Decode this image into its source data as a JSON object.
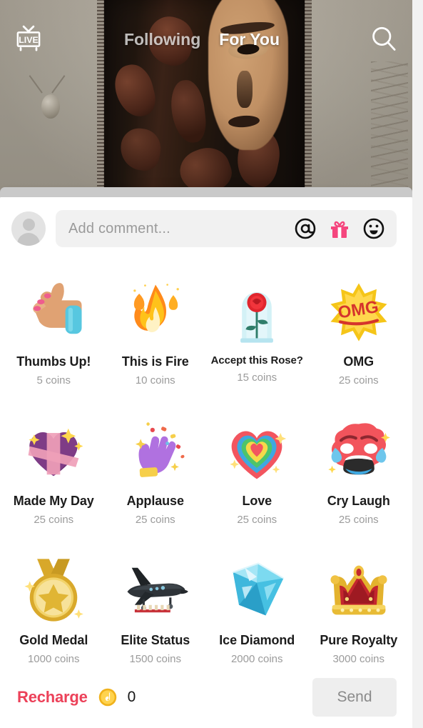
{
  "topnav": {
    "live_label": "LIVE",
    "live_icon": "live-tv-icon",
    "tabs": [
      {
        "label": "Following",
        "active": false
      },
      {
        "label": "For You",
        "active": true
      }
    ],
    "search_icon": "search-icon"
  },
  "comment_bar": {
    "avatar": "default-user-avatar",
    "placeholder": "Add comment...",
    "value": "",
    "mention_icon": "at-mention-icon",
    "gift_icon": "gift-icon",
    "emoji_icon": "emoji-smiley-icon",
    "gift_icon_color": "#f5467e"
  },
  "gifts": [
    {
      "name": "Thumbs Up!",
      "price": "5 coins",
      "art": "thumbs-up"
    },
    {
      "name": "This is Fire",
      "price": "10 coins",
      "art": "fire"
    },
    {
      "name": "Accept this Rose?",
      "price": "15 coins",
      "art": "rose-dome",
      "small": true
    },
    {
      "name": "OMG",
      "price": "25 coins",
      "art": "omg-burst"
    },
    {
      "name": "Made My Day",
      "price": "25 coins",
      "art": "gift-heart"
    },
    {
      "name": "Applause",
      "price": "25 coins",
      "art": "applause"
    },
    {
      "name": "Love",
      "price": "25 coins",
      "art": "rainbow-heart"
    },
    {
      "name": "Cry Laugh",
      "price": "25 coins",
      "art": "cry-laugh"
    },
    {
      "name": "Gold Medal",
      "price": "1000 coins",
      "art": "gold-medal"
    },
    {
      "name": "Elite Status",
      "price": "1500 coins",
      "art": "jet"
    },
    {
      "name": "Ice Diamond",
      "price": "2000 coins",
      "art": "diamond"
    },
    {
      "name": "Pure Royalty",
      "price": "3000 coins",
      "art": "crown"
    }
  ],
  "footer": {
    "recharge_label": "Recharge",
    "recharge_color": "#ec4159",
    "coin_icon": "tiktok-coin-icon",
    "balance": "0",
    "send_label": "Send",
    "send_enabled": false
  }
}
